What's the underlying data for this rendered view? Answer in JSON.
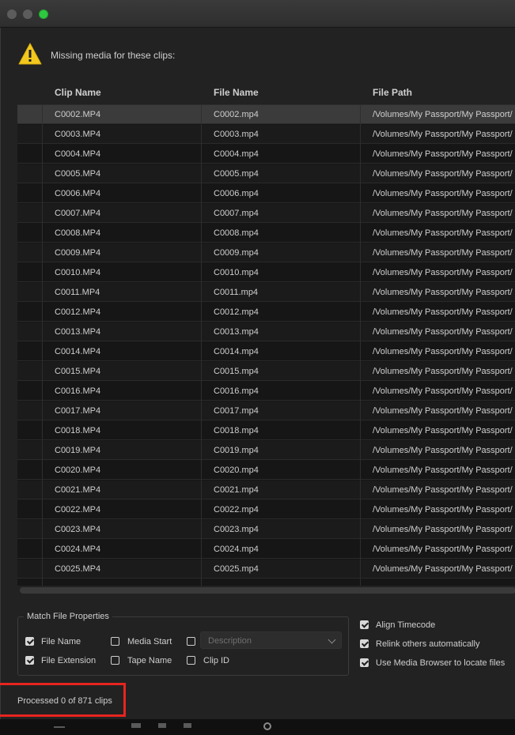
{
  "warning": {
    "text": "Missing media for these clips:"
  },
  "table": {
    "columns": [
      "Clip Name",
      "File Name",
      "File Path"
    ],
    "rows": [
      [
        "C0002.MP4",
        "C0002.mp4",
        "/Volumes/My Passport/My Passport/"
      ],
      [
        "C0003.MP4",
        "C0003.mp4",
        "/Volumes/My Passport/My Passport/"
      ],
      [
        "C0004.MP4",
        "C0004.mp4",
        "/Volumes/My Passport/My Passport/"
      ],
      [
        "C0005.MP4",
        "C0005.mp4",
        "/Volumes/My Passport/My Passport/"
      ],
      [
        "C0006.MP4",
        "C0006.mp4",
        "/Volumes/My Passport/My Passport/"
      ],
      [
        "C0007.MP4",
        "C0007.mp4",
        "/Volumes/My Passport/My Passport/"
      ],
      [
        "C0008.MP4",
        "C0008.mp4",
        "/Volumes/My Passport/My Passport/"
      ],
      [
        "C0009.MP4",
        "C0009.mp4",
        "/Volumes/My Passport/My Passport/"
      ],
      [
        "C0010.MP4",
        "C0010.mp4",
        "/Volumes/My Passport/My Passport/"
      ],
      [
        "C0011.MP4",
        "C0011.mp4",
        "/Volumes/My Passport/My Passport/"
      ],
      [
        "C0012.MP4",
        "C0012.mp4",
        "/Volumes/My Passport/My Passport/"
      ],
      [
        "C0013.MP4",
        "C0013.mp4",
        "/Volumes/My Passport/My Passport/"
      ],
      [
        "C0014.MP4",
        "C0014.mp4",
        "/Volumes/My Passport/My Passport/"
      ],
      [
        "C0015.MP4",
        "C0015.mp4",
        "/Volumes/My Passport/My Passport/"
      ],
      [
        "C0016.MP4",
        "C0016.mp4",
        "/Volumes/My Passport/My Passport/"
      ],
      [
        "C0017.MP4",
        "C0017.mp4",
        "/Volumes/My Passport/My Passport/"
      ],
      [
        "C0018.MP4",
        "C0018.mp4",
        "/Volumes/My Passport/My Passport/"
      ],
      [
        "C0019.MP4",
        "C0019.mp4",
        "/Volumes/My Passport/My Passport/"
      ],
      [
        "C0020.MP4",
        "C0020.mp4",
        "/Volumes/My Passport/My Passport/"
      ],
      [
        "C0021.MP4",
        "C0021.mp4",
        "/Volumes/My Passport/My Passport/"
      ],
      [
        "C0022.MP4",
        "C0022.mp4",
        "/Volumes/My Passport/My Passport/"
      ],
      [
        "C0023.MP4",
        "C0023.mp4",
        "/Volumes/My Passport/My Passport/"
      ],
      [
        "C0024.MP4",
        "C0024.mp4",
        "/Volumes/My Passport/My Passport/"
      ],
      [
        "C0025.MP4",
        "C0025.mp4",
        "/Volumes/My Passport/My Passport/"
      ]
    ]
  },
  "match_properties": {
    "legend": "Match File Properties",
    "file_name": {
      "label": "File Name",
      "checked": true
    },
    "file_extension": {
      "label": "File Extension",
      "checked": true
    },
    "media_start": {
      "label": "Media Start",
      "checked": false
    },
    "tape_name": {
      "label": "Tape Name",
      "checked": false
    },
    "description": {
      "checked": false,
      "placeholder": "Description"
    },
    "clip_id": {
      "label": "Clip ID",
      "checked": false
    }
  },
  "options": {
    "align_timecode": {
      "label": "Align Timecode",
      "checked": true
    },
    "relink_others": {
      "label": "Relink others automatically",
      "checked": true
    },
    "media_browser": {
      "label": "Use Media Browser to locate files",
      "checked": true
    }
  },
  "status": {
    "text": "Processed 0 of 871 clips"
  },
  "icons": {
    "warning": "warning-triangle-icon"
  },
  "colors": {
    "warning": "#f2c81e",
    "highlight": "#e8241f"
  }
}
